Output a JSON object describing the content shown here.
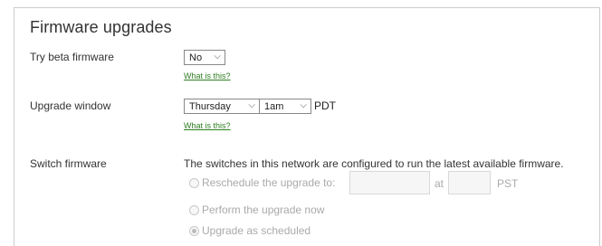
{
  "panel": {
    "title": "Firmware upgrades"
  },
  "beta": {
    "label": "Try beta firmware",
    "value": "No",
    "help": "What is this?"
  },
  "window": {
    "label": "Upgrade window",
    "day": "Thursday",
    "time": "1am",
    "timezone": "PDT",
    "help": "What is this?"
  },
  "switch": {
    "label": "Switch firmware",
    "note": "The switches in this network are configured to run the latest available firmware.",
    "options": {
      "reschedule": "Reschedule the upgrade to:",
      "at": "at",
      "timezone": "PST",
      "now": "Perform the upgrade now",
      "scheduled": "Upgrade as scheduled"
    },
    "selected": "scheduled"
  },
  "colors": {
    "link": "#2f7d22",
    "border": "#cccccc",
    "disabled_text": "#aaaaaa"
  }
}
